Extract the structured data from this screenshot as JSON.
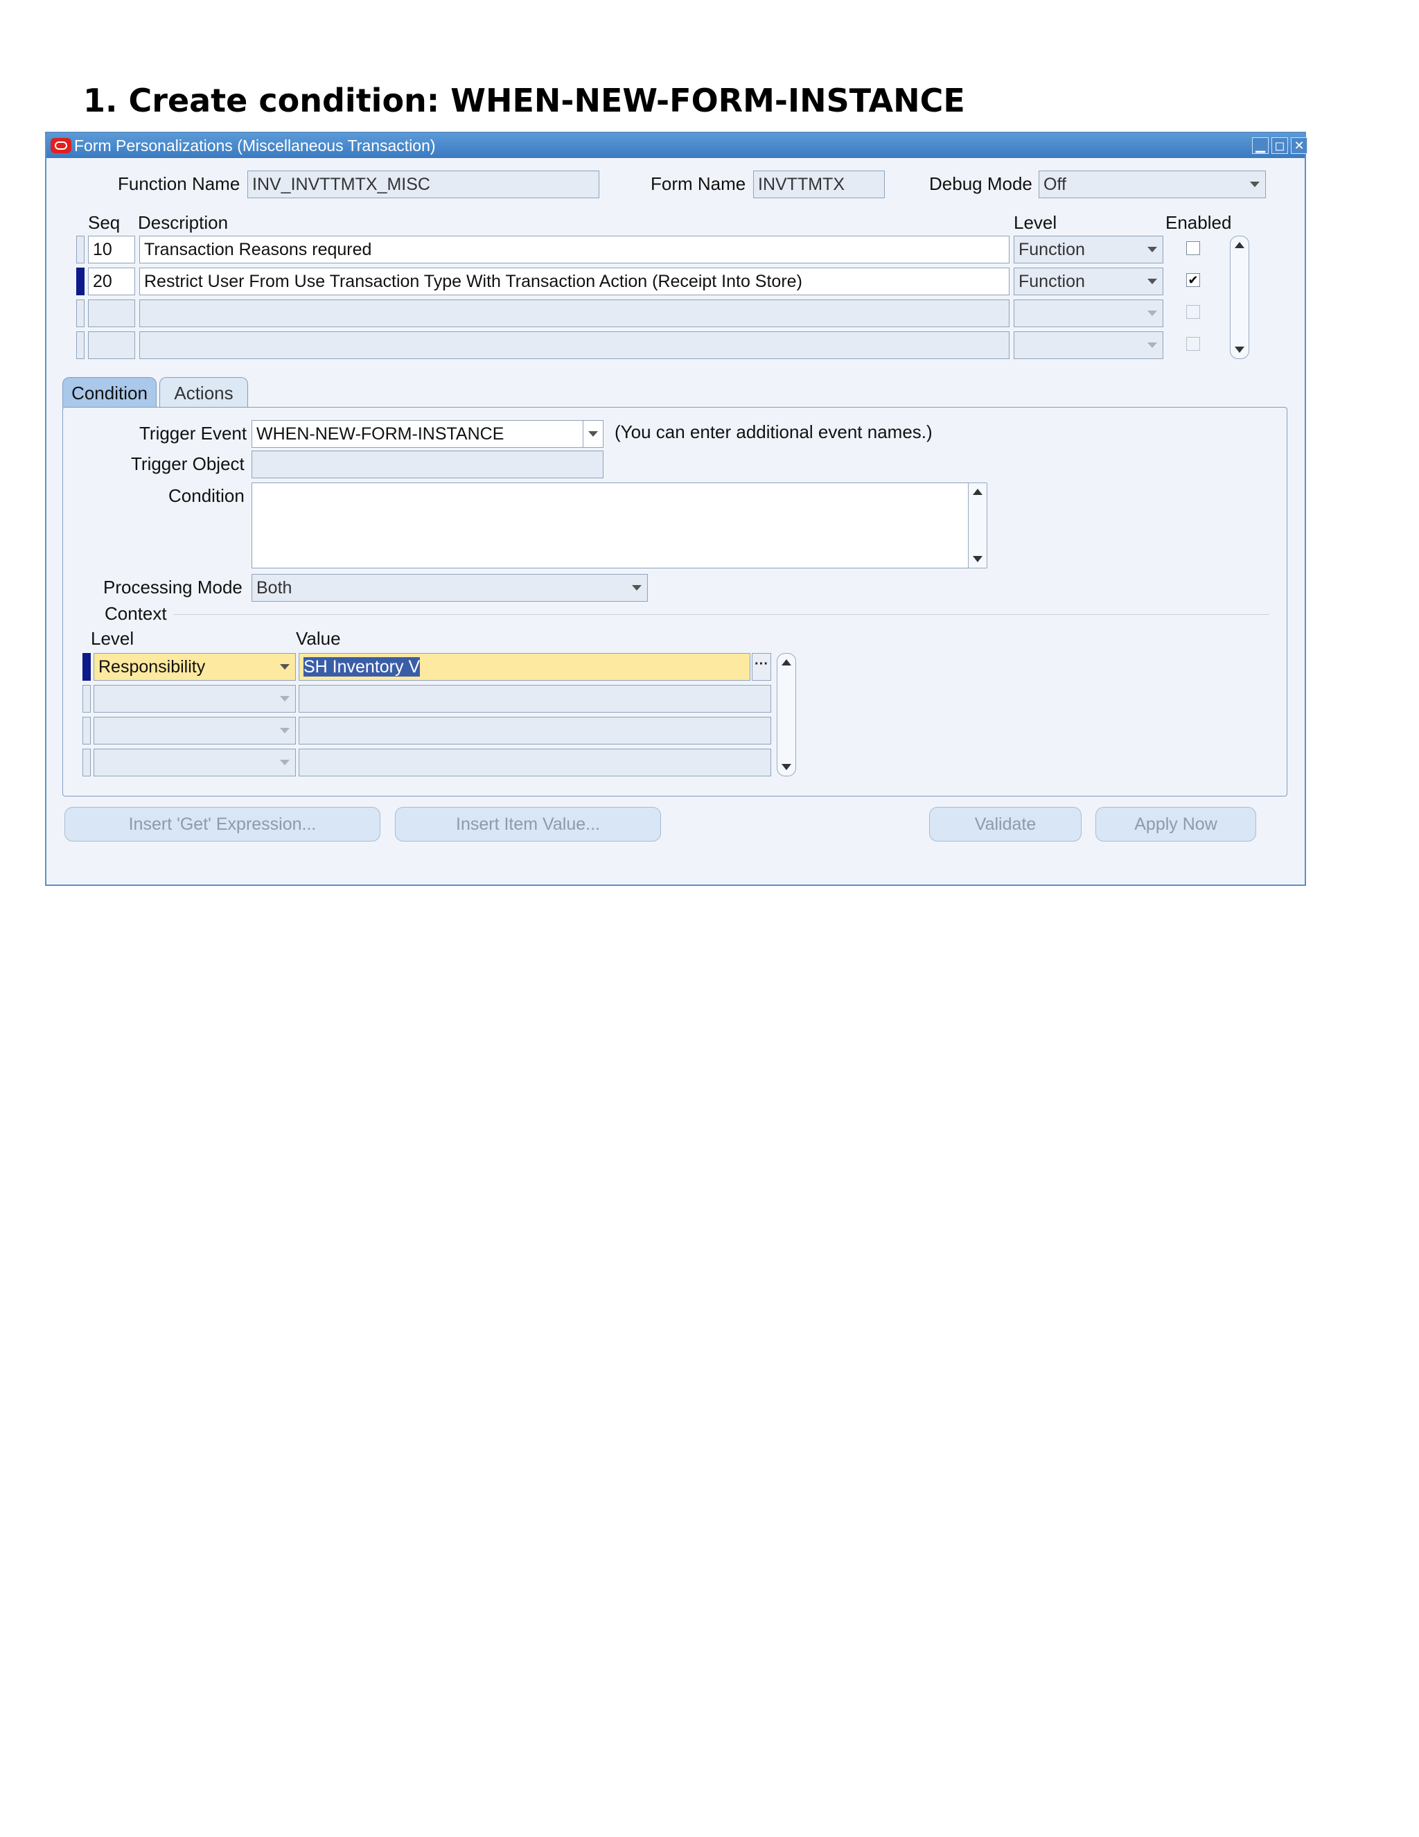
{
  "heading": "1. Create condition: WHEN-NEW-FORM-INSTANCE",
  "window": {
    "title": "Form Personalizations (Miscellaneous Transaction)",
    "controls": {
      "minimize": "▁",
      "maximize": "◻",
      "close": "✕"
    }
  },
  "header": {
    "function_name_label": "Function Name",
    "function_name_value": "INV_INVTTMTX_MISC",
    "form_name_label": "Form Name",
    "form_name_value": "INVTTMTX",
    "debug_mode_label": "Debug Mode",
    "debug_mode_value": "Off"
  },
  "rules_table": {
    "columns": {
      "seq": "Seq",
      "description": "Description",
      "level": "Level",
      "enabled": "Enabled"
    },
    "rows": [
      {
        "seq": "10",
        "description": "Transaction Reasons requred",
        "level": "Function",
        "enabled": false
      },
      {
        "seq": "20",
        "description": "Restrict User From Use Transaction Type With Transaction Action (Receipt Into Store)",
        "level": "Function",
        "enabled": true
      },
      {
        "seq": "",
        "description": "",
        "level": "",
        "enabled": false
      },
      {
        "seq": "",
        "description": "",
        "level": "",
        "enabled": false
      }
    ],
    "checkmark": "✔"
  },
  "tabs": {
    "condition": "Condition",
    "actions": "Actions"
  },
  "condition": {
    "trigger_event_label": "Trigger Event",
    "trigger_event_value": "WHEN-NEW-FORM-INSTANCE",
    "trigger_event_hint": "(You can enter additional event names.)",
    "trigger_object_label": "Trigger Object",
    "trigger_object_value": "",
    "condition_label": "Condition",
    "condition_value": "",
    "processing_mode_label": "Processing Mode",
    "processing_mode_value": "Both"
  },
  "context": {
    "section_label": "Context",
    "level_header": "Level",
    "value_header": "Value",
    "rows": [
      {
        "level": "Responsibility",
        "value": "SH Inventory V"
      },
      {
        "level": "",
        "value": ""
      },
      {
        "level": "",
        "value": ""
      },
      {
        "level": "",
        "value": ""
      }
    ],
    "lov_glyph": "···"
  },
  "buttons": {
    "insert_get_expression": "Insert 'Get' Expression...",
    "insert_item_value": "Insert Item Value...",
    "validate": "Validate",
    "apply_now": "Apply Now"
  }
}
